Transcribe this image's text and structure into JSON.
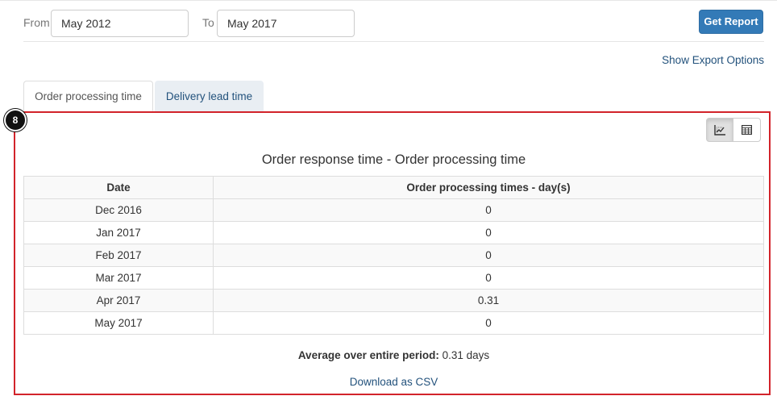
{
  "filters": {
    "from_label": "From",
    "from_value": "May 2012",
    "to_label": "To",
    "to_value": "May 2017",
    "get_report_label": "Get Report"
  },
  "export": {
    "show_options_label": "Show Export Options"
  },
  "tabs": [
    {
      "label": "Order processing time",
      "active": true
    },
    {
      "label": "Delivery lead time",
      "active": false
    }
  ],
  "annotation": {
    "step_number": "8",
    "highlight_color": "#d2232a"
  },
  "view_toggle": {
    "chart_icon": "chart-icon",
    "table_icon": "table-icon"
  },
  "report": {
    "title": "Order response time - Order processing time",
    "columns": [
      "Date",
      "Order processing times - day(s)"
    ],
    "rows": [
      {
        "date": "Dec 2016",
        "value": "0"
      },
      {
        "date": "Jan 2017",
        "value": "0"
      },
      {
        "date": "Feb 2017",
        "value": "0"
      },
      {
        "date": "Mar 2017",
        "value": "0"
      },
      {
        "date": "Apr 2017",
        "value": "0.31"
      },
      {
        "date": "May 2017",
        "value": "0"
      }
    ],
    "average_label": "Average over entire period:",
    "average_value": "0.31 days",
    "download_csv_label": "Download as CSV"
  },
  "colors": {
    "primary_button": "#337ab7",
    "link": "#23527c"
  }
}
